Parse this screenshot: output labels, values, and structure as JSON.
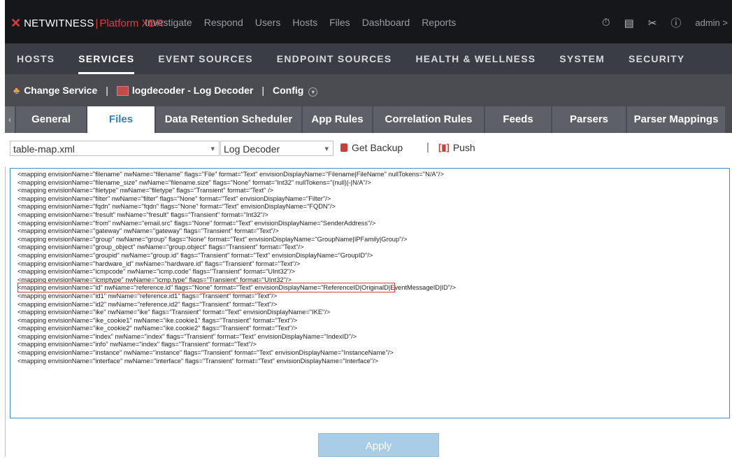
{
  "brand": {
    "name": "NETWITNESS",
    "separator": "|",
    "product": "Platform XDR"
  },
  "top_nav": [
    "Investigate",
    "Respond",
    "Users",
    "Hosts",
    "Files",
    "Dashboard",
    "Reports"
  ],
  "user": {
    "name": "admin",
    "chevron": ">"
  },
  "top_icons": [
    "timer-icon",
    "document-icon",
    "tools-icon",
    "help-icon"
  ],
  "admin_nav": [
    "HOSTS",
    "SERVICES",
    "EVENT SOURCES",
    "ENDPOINT SOURCES",
    "HEALTH & WELLNESS",
    "SYSTEM",
    "SECURITY"
  ],
  "admin_nav_active": "SERVICES",
  "service_bar": {
    "change_service": "Change Service",
    "separator": "|",
    "service_name": "logdecoder - Log Decoder",
    "config": "Config"
  },
  "tabs": [
    "General",
    "Files",
    "Data Retention Scheduler",
    "App Rules",
    "Correlation Rules",
    "Feeds",
    "Parsers",
    "Parser Mappings"
  ],
  "active_tab": "Files",
  "toolbar": {
    "file_select": "table-map.xml",
    "service_select": "Log Decoder",
    "get_backup": "Get Backup",
    "separator": "|",
    "push": "Push"
  },
  "file_lines": [
    "<mapping envisionName=\"filename\" nwName=\"filename\" flags=\"File\" format=\"Text\" envisionDisplayName=\"Filename|FileName\" nullTokens=\"N/A\"/>",
    "<mapping envisionName=\"filename_size\" nwName=\"filename.size\" flags=\"None\" format=\"Int32\" nullTokens=\"(null)|-|N/A\"/>",
    "<mapping envisionName=\"filetype\" nwName=\"filetype\" flags=\"Transient\" format=\"Text\" />",
    "<mapping envisionName=\"filter\" nwName=\"filter\" flags=\"None\" format=\"Text\" envisionDisplayName=\"Filter\"/>",
    "<mapping envisionName=\"fqdn\" nwName=\"fqdn\" flags=\"None\" format=\"Text\" envisionDisplayName=\"FQDN\"/>",
    "<mapping envisionName=\"fresult\" nwName=\"fresult\" flags=\"Transient\" format=\"Int32\"/>",
    "<mapping envisionName=\"from\" nwName=\"email.src\" flags=\"None\" format=\"Text\" envisionDisplayName=\"SenderAddress\"/>",
    "<mapping envisionName=\"gateway\" nwName=\"gateway\" flags=\"Transient\" format=\"Text\"/>",
    "<mapping envisionName=\"group\" nwName=\"group\" flags=\"None\" format=\"Text\" envisionDisplayName=\"GroupName|IPFamily|Group\"/>",
    "<mapping envisionName=\"group_object\" nwName=\"group.object\" flags=\"Transient\" format=\"Text\"/>",
    "<mapping envisionName=\"groupid\" nwName=\"group.id\" flags=\"Transient\" format=\"Text\" envisionDisplayName=\"GroupID\"/>",
    "<mapping envisionName=\"hardware_id\" nwName=\"hardware.id\" flags=\"Transient\" format=\"Text\"/>",
    "<mapping envisionName=\"icmpcode\" nwName=\"icmp.code\" flags=\"Transient\" format=\"UInt32\"/>",
    "<mapping envisionName=\"icmptype\" nwName=\"icmp.type\" flags=\"Transient\" format=\"UInt32\"/>",
    "<mapping envisionName=\"id\" nwName=\"reference.id\" flags=\"None\" format=\"Text\" envisionDisplayName=\"ReferenceID|OriginalD|EventMessageID|ID\"/>",
    "<mapping envisionName=\"id1\" nwName=\"reference.id1\" flags=\"Transient\" format=\"Text\"/>",
    "<mapping envisionName=\"id2\" nwName=\"reference.id2\" flags=\"Transient\" format=\"Text\"/>",
    "<mapping envisionName=\"ike\" nwName=\"ike\" flags=\"Transient\" format=\"Text\" envisionDisplayName=\"IKE\"/>",
    "<mapping envisionName=\"ike_cookie1\" nwName=\"ike.cookie1\" flags=\"Transient\" format=\"Text\"/>",
    "<mapping envisionName=\"ike_cookie2\" nwName=\"ike.cookie2\" flags=\"Transient\" format=\"Text\"/>",
    "<mapping envisionName=\"index\" nwName=\"index\" flags=\"Transient\" format=\"Text\" envisionDisplayName=\"IndexID\"/>",
    "<mapping envisionName=\"info\" nwName=\"index\" flags=\"Transient\" format=\"Text\"/>",
    "<mapping envisionName=\"instance\" nwName=\"instance\" flags=\"Transient\" format=\"Text\" envisionDisplayName=\"InstanceName\"/>",
    "<mapping envisionName=\"interface\" nwName=\"interface\" flags=\"Transient\" format=\"Text\" envisionDisplayName=\"Interface\"/>"
  ],
  "apply_label": "Apply",
  "colors": {
    "brand_accent": "#e23b3b",
    "active_tab_text": "#2f83b8",
    "highlight_border": "#d9413b",
    "editor_border": "#3f90c9",
    "apply_bg": "#a9cde6"
  }
}
